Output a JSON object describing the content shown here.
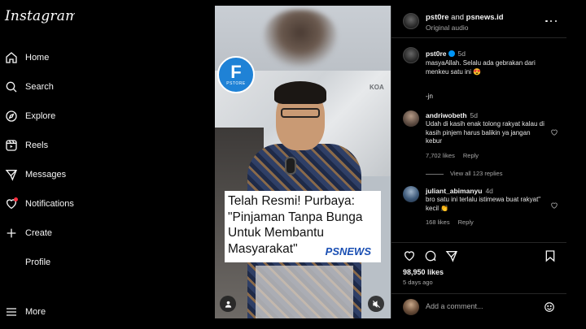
{
  "app": {
    "logo": "Instagram"
  },
  "nav": [
    {
      "label": "Home",
      "icon": "home-icon"
    },
    {
      "label": "Search",
      "icon": "search-icon"
    },
    {
      "label": "Explore",
      "icon": "compass-icon"
    },
    {
      "label": "Reels",
      "icon": "reels-icon"
    },
    {
      "label": "Messages",
      "icon": "messages-icon"
    },
    {
      "label": "Notifications",
      "icon": "heart-icon"
    },
    {
      "label": "Create",
      "icon": "plus-icon"
    },
    {
      "label": "Profile",
      "icon": "profile-icon"
    },
    {
      "label": "More",
      "icon": "menu-icon"
    }
  ],
  "post": {
    "media": {
      "badge_letter": "F",
      "badge_text": "PSTORE",
      "background_text": "KOA",
      "caption": "Telah Resmi! Purbaya: \"Pinjaman Tanpa Bunga Untuk Membantu Masyarakat\"",
      "watermark": "PSNEWS"
    },
    "header": {
      "author": "pst0re",
      "joiner": "and",
      "collaborator": "psnews.id",
      "audio": "Original audio"
    },
    "caption_comment": {
      "user": "pst0re",
      "age": "5d",
      "text": "masyaAllah. Selalu ada gebrakan dari menkeu satu ini 😍",
      "signoff": "-jn"
    },
    "comments": [
      {
        "user": "andriwobeth",
        "age": "5d",
        "text": "Udah di kasih enak tolong rakyat kalau di kasih pinjem harus balikin ya jangan kebur",
        "likes": "7,702 likes",
        "reply": "Reply",
        "view_replies": "View all 123 replies"
      },
      {
        "user": "juliant_abimanyu",
        "age": "4d",
        "text": "bro satu ini terlalu istimewa buat rakyat\" kecil 👏",
        "likes": "168 likes",
        "reply": "Reply"
      }
    ],
    "likes": "98,950 likes",
    "date": "5 days ago",
    "add_comment_placeholder": "Add a comment..."
  },
  "colors": {
    "background": "#000000",
    "text": "#f5f5f5",
    "muted": "#a8a8a8",
    "notification_dot": "#ff3040",
    "verified": "#0095f6",
    "psnews_blue": "#1a4fb3",
    "pstore_blue": "#1f82d6"
  }
}
